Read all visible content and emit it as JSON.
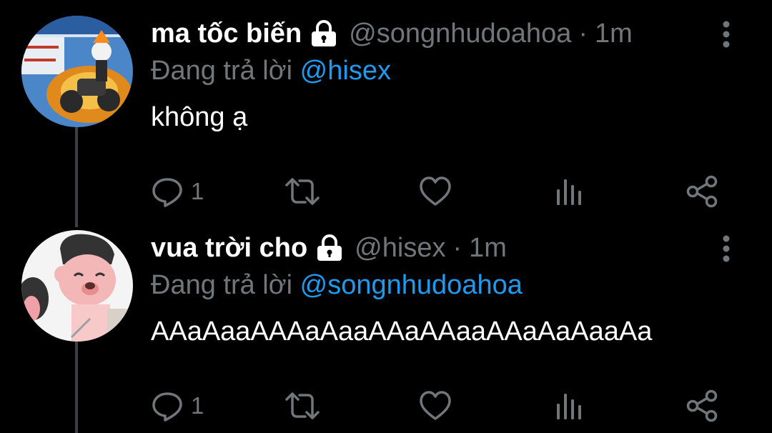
{
  "colors": {
    "background": "#000000",
    "primary_text": "#ffffff",
    "secondary_text": "#71767b",
    "link": "#1d9bf0",
    "thread_line": "#3c4043"
  },
  "tweets": [
    {
      "display_name": "ma tốc biến",
      "handle": "@songnhudoahoa",
      "separator": "·",
      "time": "1m",
      "reply_prefix": "Đang trả lời",
      "reply_handle": "@hisex",
      "text": "không ạ",
      "reply_count": "1",
      "icons": [
        "lock-icon",
        "more-vertical-icon",
        "reply-icon",
        "retweet-icon",
        "like-icon",
        "analytics-icon",
        "share-icon"
      ],
      "avatar": "ghost-rider-motorcycle-image"
    },
    {
      "display_name": "vua trời cho",
      "handle": "@hisex",
      "separator": "·",
      "time": "1m",
      "reply_prefix": "Đang trả lời",
      "reply_handle": "@songnhudoahoa",
      "text": "AAaAaaAAAaAaaAAaAAaaAAaAaAaaAa",
      "reply_count": "1",
      "icons": [
        "lock-icon",
        "more-vertical-icon",
        "reply-icon",
        "retweet-icon",
        "like-icon",
        "analytics-icon",
        "share-icon"
      ],
      "avatar": "cartoon-pig-character-image"
    }
  ]
}
